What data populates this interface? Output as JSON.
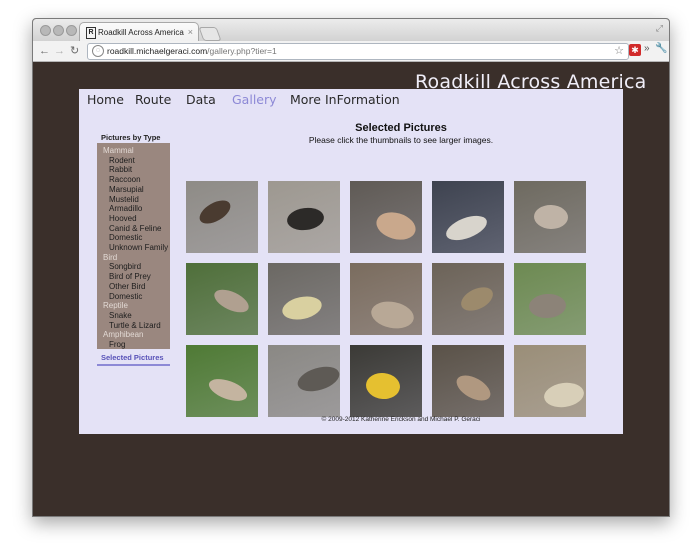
{
  "browser": {
    "tab_title": "Roadkill Across America - C",
    "tab_close": "×",
    "url_host": "roadkill.michaelgeraci.com",
    "url_path": "/gallery.php?tier=1"
  },
  "site": {
    "title": "Roadkill Across America"
  },
  "nav": {
    "items": [
      "Home",
      "Route",
      "Data",
      "Gallery",
      "More InFormation"
    ],
    "active": "Gallery"
  },
  "sidebar": {
    "heading": "Pictures by Type",
    "groups": [
      {
        "label": "Mammal",
        "items": [
          "Rodent",
          "Rabbit",
          "Raccoon",
          "Marsupial",
          "Mustelid",
          "Armadillo",
          "Hooved",
          "Canid & Feline",
          "Domestic",
          "Unknown Family"
        ]
      },
      {
        "label": "Bird",
        "items": [
          "Songbird",
          "Bird of Prey",
          "Other Bird",
          "Domestic"
        ]
      },
      {
        "label": "Reptile",
        "items": [
          "Snake",
          "Turtle & Lizard"
        ]
      },
      {
        "label": "Amphibean",
        "items": [
          "Frog"
        ]
      }
    ],
    "selected_label": "Selected Pictures"
  },
  "main": {
    "title": "Selected Pictures",
    "subtitle": "Please click the thumbnails to see larger images."
  },
  "thumbnails": [
    {
      "bg": "#8e8b86",
      "spot": "#4a3b30"
    },
    {
      "bg": "#9d9890",
      "spot": "#2c2a28"
    },
    {
      "bg": "#5f5a55",
      "spot": "#c9a88c"
    },
    {
      "bg": "#3e4350",
      "spot": "#d8d4cc"
    },
    {
      "bg": "#6e6a60",
      "spot": "#bfb3a6"
    },
    {
      "bg": "#4f6f3a",
      "spot": "#b0a090"
    },
    {
      "bg": "#6b6863",
      "spot": "#d9d0a0"
    },
    {
      "bg": "#7a6c5e",
      "spot": "#b8a896"
    },
    {
      "bg": "#6c6358",
      "spot": "#9c8a6c"
    },
    {
      "bg": "#6d8a52",
      "spot": "#8c8378"
    },
    {
      "bg": "#4f7a35",
      "spot": "#c4b4a0"
    },
    {
      "bg": "#8a8884",
      "spot": "#5e5a55"
    },
    {
      "bg": "#3b3a36",
      "spot": "#e5c030"
    },
    {
      "bg": "#5a5248",
      "spot": "#b09880"
    },
    {
      "bg": "#9a8e78",
      "spot": "#d8cfb8"
    }
  ],
  "footer": "© 2009-2012 Katherine Erickson and Michael P. Geraci"
}
